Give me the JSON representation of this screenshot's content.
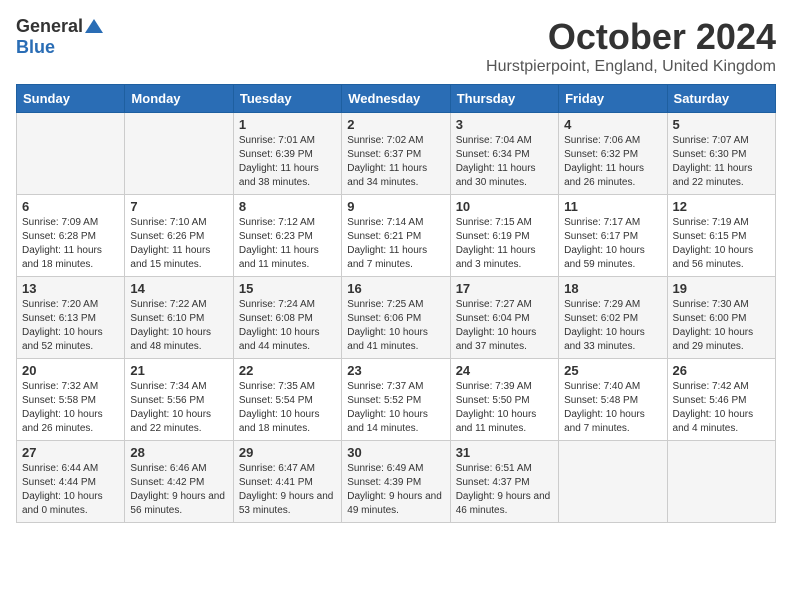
{
  "logo": {
    "general": "General",
    "blue": "Blue"
  },
  "title": "October 2024",
  "location": "Hurstpierpoint, England, United Kingdom",
  "days_of_week": [
    "Sunday",
    "Monday",
    "Tuesday",
    "Wednesday",
    "Thursday",
    "Friday",
    "Saturday"
  ],
  "weeks": [
    [
      {
        "day": "",
        "info": ""
      },
      {
        "day": "",
        "info": ""
      },
      {
        "day": "1",
        "info": "Sunrise: 7:01 AM\nSunset: 6:39 PM\nDaylight: 11 hours and 38 minutes."
      },
      {
        "day": "2",
        "info": "Sunrise: 7:02 AM\nSunset: 6:37 PM\nDaylight: 11 hours and 34 minutes."
      },
      {
        "day": "3",
        "info": "Sunrise: 7:04 AM\nSunset: 6:34 PM\nDaylight: 11 hours and 30 minutes."
      },
      {
        "day": "4",
        "info": "Sunrise: 7:06 AM\nSunset: 6:32 PM\nDaylight: 11 hours and 26 minutes."
      },
      {
        "day": "5",
        "info": "Sunrise: 7:07 AM\nSunset: 6:30 PM\nDaylight: 11 hours and 22 minutes."
      }
    ],
    [
      {
        "day": "6",
        "info": "Sunrise: 7:09 AM\nSunset: 6:28 PM\nDaylight: 11 hours and 18 minutes."
      },
      {
        "day": "7",
        "info": "Sunrise: 7:10 AM\nSunset: 6:26 PM\nDaylight: 11 hours and 15 minutes."
      },
      {
        "day": "8",
        "info": "Sunrise: 7:12 AM\nSunset: 6:23 PM\nDaylight: 11 hours and 11 minutes."
      },
      {
        "day": "9",
        "info": "Sunrise: 7:14 AM\nSunset: 6:21 PM\nDaylight: 11 hours and 7 minutes."
      },
      {
        "day": "10",
        "info": "Sunrise: 7:15 AM\nSunset: 6:19 PM\nDaylight: 11 hours and 3 minutes."
      },
      {
        "day": "11",
        "info": "Sunrise: 7:17 AM\nSunset: 6:17 PM\nDaylight: 10 hours and 59 minutes."
      },
      {
        "day": "12",
        "info": "Sunrise: 7:19 AM\nSunset: 6:15 PM\nDaylight: 10 hours and 56 minutes."
      }
    ],
    [
      {
        "day": "13",
        "info": "Sunrise: 7:20 AM\nSunset: 6:13 PM\nDaylight: 10 hours and 52 minutes."
      },
      {
        "day": "14",
        "info": "Sunrise: 7:22 AM\nSunset: 6:10 PM\nDaylight: 10 hours and 48 minutes."
      },
      {
        "day": "15",
        "info": "Sunrise: 7:24 AM\nSunset: 6:08 PM\nDaylight: 10 hours and 44 minutes."
      },
      {
        "day": "16",
        "info": "Sunrise: 7:25 AM\nSunset: 6:06 PM\nDaylight: 10 hours and 41 minutes."
      },
      {
        "day": "17",
        "info": "Sunrise: 7:27 AM\nSunset: 6:04 PM\nDaylight: 10 hours and 37 minutes."
      },
      {
        "day": "18",
        "info": "Sunrise: 7:29 AM\nSunset: 6:02 PM\nDaylight: 10 hours and 33 minutes."
      },
      {
        "day": "19",
        "info": "Sunrise: 7:30 AM\nSunset: 6:00 PM\nDaylight: 10 hours and 29 minutes."
      }
    ],
    [
      {
        "day": "20",
        "info": "Sunrise: 7:32 AM\nSunset: 5:58 PM\nDaylight: 10 hours and 26 minutes."
      },
      {
        "day": "21",
        "info": "Sunrise: 7:34 AM\nSunset: 5:56 PM\nDaylight: 10 hours and 22 minutes."
      },
      {
        "day": "22",
        "info": "Sunrise: 7:35 AM\nSunset: 5:54 PM\nDaylight: 10 hours and 18 minutes."
      },
      {
        "day": "23",
        "info": "Sunrise: 7:37 AM\nSunset: 5:52 PM\nDaylight: 10 hours and 14 minutes."
      },
      {
        "day": "24",
        "info": "Sunrise: 7:39 AM\nSunset: 5:50 PM\nDaylight: 10 hours and 11 minutes."
      },
      {
        "day": "25",
        "info": "Sunrise: 7:40 AM\nSunset: 5:48 PM\nDaylight: 10 hours and 7 minutes."
      },
      {
        "day": "26",
        "info": "Sunrise: 7:42 AM\nSunset: 5:46 PM\nDaylight: 10 hours and 4 minutes."
      }
    ],
    [
      {
        "day": "27",
        "info": "Sunrise: 6:44 AM\nSunset: 4:44 PM\nDaylight: 10 hours and 0 minutes."
      },
      {
        "day": "28",
        "info": "Sunrise: 6:46 AM\nSunset: 4:42 PM\nDaylight: 9 hours and 56 minutes."
      },
      {
        "day": "29",
        "info": "Sunrise: 6:47 AM\nSunset: 4:41 PM\nDaylight: 9 hours and 53 minutes."
      },
      {
        "day": "30",
        "info": "Sunrise: 6:49 AM\nSunset: 4:39 PM\nDaylight: 9 hours and 49 minutes."
      },
      {
        "day": "31",
        "info": "Sunrise: 6:51 AM\nSunset: 4:37 PM\nDaylight: 9 hours and 46 minutes."
      },
      {
        "day": "",
        "info": ""
      },
      {
        "day": "",
        "info": ""
      }
    ]
  ]
}
